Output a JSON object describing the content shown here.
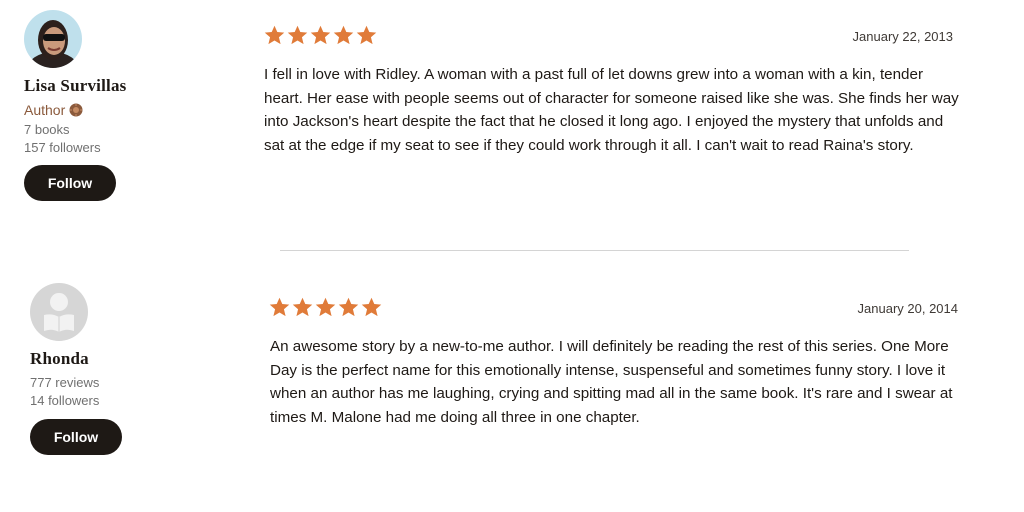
{
  "reviews": [
    {
      "reviewer": {
        "name": "Lisa Survillas",
        "role": "Author",
        "stats": [
          "7 books",
          "157 followers"
        ],
        "avatar": "profile-photo"
      },
      "follow_label": "Follow",
      "rating": 5,
      "date": "January 22, 2013",
      "text": "I fell in love with Ridley. A woman with a past full of let downs grew into a woman with a kin, tender heart. Her ease with people seems out of character for someone raised like she was. She finds her way into Jackson's heart despite the fact that he closed it long ago. I enjoyed the mystery that unfolds and sat at the edge if my seat to see if they could work through it all. I can't wait to read Raina's story."
    },
    {
      "reviewer": {
        "name": "Rhonda",
        "stats": [
          "777 reviews",
          "14 followers"
        ],
        "avatar": "default-reader-avatar"
      },
      "follow_label": "Follow",
      "rating": 5,
      "date": "January 20, 2014",
      "text": "An awesome story by a new-to-me author. I will definitely be reading the rest of this series. One More Day is the perfect name for this emotionally intense, suspenseful and sometimes funny story. I love it when an author has me laughing, crying and spitting mad all in the same book. It's rare and I swear at times M. Malone had me doing all three in one chapter."
    }
  ],
  "colors": {
    "star": "#e07b39",
    "author_label": "#8b5a3c",
    "button_bg": "#1e1915",
    "divider": "#d4d4d4"
  },
  "icons": {
    "star": "star-icon",
    "author_badge": "author-badge-icon"
  }
}
